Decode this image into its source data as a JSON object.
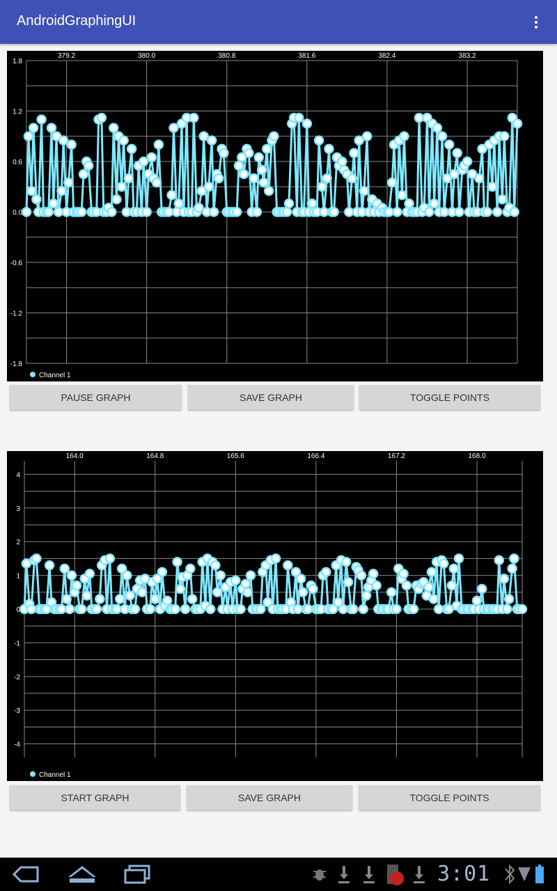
{
  "app": {
    "title": "AndroidGraphingUI",
    "overflow_icon": "more-vert-icon"
  },
  "colors": {
    "appbar": "#3f51b5",
    "series": "#7fe8ff",
    "grid": "#8a8a8a",
    "button": "#d6d6d6"
  },
  "graphs": [
    {
      "buttons": {
        "pause": "PAUSE GRAPH",
        "save": "SAVE GRAPH",
        "toggle": "TOGGLE POINTS"
      },
      "chart_data": {
        "type": "line",
        "x_ticks": [
          "379.2",
          "380.0",
          "380.8",
          "381.6",
          "382.4",
          "383.2"
        ],
        "y_ticks": [
          "1.8",
          "1.2",
          "0.6",
          "0.0",
          "-0.6",
          "-1.2",
          "-1.8"
        ],
        "ylim": [
          -1.8,
          1.8
        ],
        "xlim": [
          378.8,
          383.7
        ],
        "legend": "top-left-below",
        "series": [
          {
            "name": "Channel 1",
            "x": [
              378.8,
              378.82,
              378.85,
              378.87,
              378.9,
              378.92,
              378.95,
              378.97,
              379.0,
              379.02,
              379.05,
              379.07,
              379.1,
              379.12,
              379.15,
              379.17,
              379.2,
              379.22,
              379.25,
              379.27,
              379.3,
              379.32,
              379.35,
              379.37,
              379.4,
              379.42,
              379.45,
              379.47,
              379.5,
              379.52,
              379.55,
              379.57,
              379.6,
              379.62,
              379.65,
              379.67,
              379.7,
              379.72,
              379.75,
              379.77,
              379.8,
              379.82,
              379.85,
              379.87,
              379.9,
              379.92,
              379.95,
              379.97,
              380.0,
              380.02,
              380.05,
              380.07,
              380.1,
              380.12,
              380.15,
              380.17,
              380.2,
              380.22,
              380.25,
              380.27,
              380.3,
              380.32,
              380.35,
              380.37,
              380.4,
              380.42,
              380.45,
              380.47,
              380.5,
              380.52,
              380.55,
              380.57,
              380.6,
              380.62,
              380.65,
              380.67,
              380.7,
              380.72,
              380.75,
              380.77,
              380.8,
              380.82,
              380.85,
              380.87,
              380.9,
              380.92,
              380.95,
              380.97,
              381.0,
              381.02,
              381.05,
              381.07,
              381.1,
              381.12,
              381.15,
              381.17,
              381.2,
              381.22,
              381.25,
              381.27,
              381.3,
              381.32,
              381.35,
              381.37,
              381.4,
              381.42,
              381.45,
              381.47,
              381.5,
              381.52,
              381.55,
              381.57,
              381.6,
              381.62,
              381.65,
              381.67,
              381.7,
              381.72,
              381.75,
              381.77,
              381.8,
              381.82,
              381.85,
              381.87,
              381.9,
              381.92,
              381.95,
              381.97,
              382.0,
              382.02,
              382.05,
              382.07,
              382.1,
              382.12,
              382.15,
              382.17,
              382.2,
              382.22,
              382.25,
              382.27,
              382.3,
              382.32,
              382.35,
              382.37,
              382.4,
              382.42,
              382.45,
              382.47,
              382.5,
              382.52,
              382.55,
              382.57,
              382.6,
              382.62,
              382.65,
              382.67,
              382.7,
              382.72,
              382.75,
              382.77,
              382.8,
              382.82,
              382.85,
              382.87,
              382.9,
              382.92,
              382.95,
              382.97,
              383.0,
              383.02,
              383.05,
              383.07,
              383.1,
              383.12,
              383.15,
              383.17,
              383.2,
              383.22,
              383.25,
              383.27,
              383.3,
              383.32,
              383.35,
              383.37,
              383.4,
              383.42,
              383.45,
              383.47,
              383.5,
              383.52,
              383.55,
              383.57,
              383.6,
              383.62,
              383.65,
              383.67,
              383.7
            ],
            "y": [
              0.0,
              0.9,
              0.25,
              1.0,
              0.15,
              0.0,
              1.1,
              0.0,
              0.0,
              0.0,
              1.0,
              0.1,
              0.9,
              0.0,
              0.25,
              0.85,
              0.0,
              0.35,
              0.8,
              0.0,
              0.0,
              0.0,
              0.0,
              0.45,
              0.6,
              0.55,
              0.0,
              0.0,
              0.0,
              1.1,
              1.12,
              0.0,
              0.0,
              0.05,
              0.0,
              1.0,
              0.15,
              0.9,
              0.3,
              0.85,
              0.0,
              0.4,
              0.75,
              0.0,
              0.0,
              0.55,
              0.0,
              0.6,
              0.0,
              0.45,
              0.65,
              0.4,
              0.35,
              0.8,
              0.0,
              0.0,
              0.0,
              0.0,
              0.2,
              1.0,
              0.0,
              0.1,
              1.05,
              0.0,
              1.12,
              0.0,
              0.0,
              1.12,
              0.0,
              0.05,
              0.25,
              0.9,
              0.0,
              0.3,
              0.85,
              0.0,
              0.45,
              0.4,
              0.75,
              0.7,
              0.0,
              0.0,
              0.0,
              0.0,
              0.0,
              0.55,
              0.65,
              0.45,
              0.75,
              0.7,
              0.0,
              0.4,
              0.0,
              0.65,
              0.5,
              0.35,
              0.75,
              0.25,
              0.85,
              0.9,
              0.0,
              0.0,
              0.0,
              0.0,
              0.0,
              0.1,
              1.05,
              1.12,
              0.0,
              1.12,
              0.0,
              0.0,
              1.05,
              0.0,
              0.1,
              0.0,
              0.0,
              0.85,
              0.3,
              0.0,
              0.4,
              0.75,
              0.0,
              0.0,
              0.65,
              0.55,
              0.6,
              0.5,
              0.45,
              0.0,
              0.4,
              0.7,
              0.0,
              0.85,
              0.0,
              0.25,
              0.9,
              0.0,
              0.15,
              0.0,
              0.1,
              0.0,
              0.05,
              0.0,
              0.0,
              0.0,
              0.35,
              0.8,
              0.0,
              0.85,
              0.2,
              0.9,
              0.0,
              0.1,
              0.0,
              0.0,
              0.0,
              1.12,
              0.0,
              0.05,
              1.12,
              0.0,
              1.05,
              0.1,
              1.0,
              0.0,
              0.9,
              0.0,
              0.4,
              0.8,
              0.0,
              0.45,
              0.7,
              0.0,
              0.5,
              0.55,
              0.6,
              0.0,
              0.45,
              0.0,
              0.0,
              0.4,
              0.75,
              0.0,
              0.0,
              0.8,
              0.3,
              0.85,
              0.0,
              0.9,
              0.15,
              0.9,
              0.0,
              0.05,
              1.12,
              0.0,
              1.05,
              0.1,
              0.0,
              0.0,
              0.05,
              0.25,
              0.9,
              0.8,
              0.05
            ]
          }
        ]
      }
    },
    {
      "buttons": {
        "pause": "START GRAPH",
        "save": "SAVE GRAPH",
        "toggle": "TOGGLE POINTS"
      },
      "chart_data": {
        "type": "line",
        "x_ticks": [
          "164.0",
          "164.8",
          "165.6",
          "166.4",
          "167.2",
          "168.0"
        ],
        "y_ticks": [
          "4",
          "3",
          "2",
          "1",
          "0",
          "-1",
          "-2",
          "-3",
          "-4"
        ],
        "ylim": [
          -4.4,
          4.4
        ],
        "xlim": [
          163.5,
          168.45
        ],
        "legend": "top-left-below",
        "series": [
          {
            "name": "Channel 1",
            "x": [
              163.5,
              163.52,
              163.55,
              163.57,
              163.6,
              163.62,
              163.65,
              163.67,
              163.7,
              163.72,
              163.75,
              163.77,
              163.8,
              163.82,
              163.85,
              163.87,
              163.9,
              163.92,
              163.95,
              163.97,
              164.0,
              164.02,
              164.05,
              164.07,
              164.1,
              164.12,
              164.15,
              164.17,
              164.2,
              164.22,
              164.25,
              164.27,
              164.3,
              164.32,
              164.35,
              164.37,
              164.4,
              164.42,
              164.45,
              164.47,
              164.5,
              164.52,
              164.55,
              164.57,
              164.6,
              164.62,
              164.65,
              164.67,
              164.7,
              164.72,
              164.75,
              164.77,
              164.8,
              164.82,
              164.85,
              164.87,
              164.9,
              164.92,
              164.95,
              164.97,
              165.0,
              165.02,
              165.05,
              165.07,
              165.1,
              165.12,
              165.15,
              165.17,
              165.2,
              165.22,
              165.25,
              165.27,
              165.3,
              165.32,
              165.35,
              165.37,
              165.4,
              165.42,
              165.45,
              165.47,
              165.5,
              165.52,
              165.55,
              165.57,
              165.6,
              165.62,
              165.65,
              165.67,
              165.7,
              165.72,
              165.75,
              165.77,
              165.8,
              165.82,
              165.85,
              165.87,
              165.9,
              165.92,
              165.95,
              165.97,
              166.0,
              166.02,
              166.05,
              166.07,
              166.1,
              166.12,
              166.15,
              166.17,
              166.2,
              166.22,
              166.25,
              166.27,
              166.3,
              166.32,
              166.35,
              166.37,
              166.4,
              166.42,
              166.45,
              166.47,
              166.5,
              166.52,
              166.55,
              166.57,
              166.6,
              166.62,
              166.65,
              166.67,
              166.7,
              166.72,
              166.75,
              166.77,
              166.8,
              166.82,
              166.85,
              166.87,
              166.9,
              166.92,
              166.95,
              166.97,
              167.0,
              167.02,
              167.05,
              167.07,
              167.1,
              167.12,
              167.15,
              167.17,
              167.2,
              167.22,
              167.25,
              167.27,
              167.3,
              167.32,
              167.35,
              167.37,
              167.4,
              167.42,
              167.45,
              167.47,
              167.5,
              167.52,
              167.55,
              167.57,
              167.6,
              167.62,
              167.65,
              167.67,
              167.7,
              167.72,
              167.75,
              167.77,
              167.8,
              167.82,
              167.85,
              167.87,
              167.9,
              167.92,
              167.95,
              167.97,
              168.0,
              168.02,
              168.05,
              168.07,
              168.1,
              168.12,
              168.15,
              168.17,
              168.2,
              168.22,
              168.25,
              168.27,
              168.3,
              168.32,
              168.35,
              168.37,
              168.4,
              168.42,
              168.45
            ],
            "y": [
              0.0,
              1.35,
              0.15,
              0.0,
              1.45,
              1.5,
              0.0,
              0.0,
              0.0,
              0.0,
              1.3,
              0.2,
              0.0,
              0.0,
              0.0,
              0.0,
              1.2,
              0.3,
              0.0,
              1.0,
              0.5,
              0.7,
              0.0,
              0.0,
              0.9,
              0.4,
              1.05,
              0.0,
              0.0,
              0.0,
              0.3,
              1.3,
              1.45,
              0.0,
              1.5,
              0.0,
              0.0,
              0.0,
              0.3,
              1.2,
              0.0,
              1.0,
              0.4,
              0.0,
              0.0,
              0.6,
              0.85,
              0.5,
              0.9,
              0.0,
              0.0,
              0.8,
              0.3,
              0.9,
              0.0,
              1.1,
              0.1,
              0.25,
              0.0,
              0.0,
              0.0,
              1.4,
              0.6,
              0.95,
              0.0,
              1.0,
              1.2,
              0.3,
              0.0,
              0.0,
              0.0,
              1.4,
              0.1,
              1.5,
              0.0,
              1.4,
              1.3,
              0.5,
              1.0,
              0.0,
              0.65,
              0.0,
              0.8,
              0.0,
              0.85,
              0.0,
              0.0,
              0.6,
              0.75,
              0.5,
              1.0,
              0.0,
              0.0,
              0.0,
              0.0,
              1.1,
              1.3,
              0.2,
              1.45,
              0.0,
              1.5,
              0.0,
              0.0,
              0.0,
              0.0,
              1.3,
              0.2,
              0.0,
              1.1,
              0.0,
              0.9,
              0.5,
              0.0,
              0.0,
              0.7,
              0.6,
              0.0,
              0.0,
              0.0,
              1.0,
              1.1,
              0.0,
              0.0,
              0.0,
              1.3,
              0.2,
              1.45,
              0.0,
              1.4,
              0.8,
              0.0,
              0.0,
              1.25,
              1.15,
              1.0,
              0.0,
              0.4,
              0.65,
              0.85,
              1.05,
              0.7,
              0.0,
              0.0,
              0.0,
              0.0,
              0.0,
              0.5,
              0.0,
              0.0,
              1.2,
              0.9,
              1.05,
              0.7,
              0.0,
              0.0,
              0.0,
              0.7,
              0.6,
              0.75,
              0.8,
              0.4,
              0.65,
              1.1,
              0.3,
              1.4,
              0.0,
              1.45,
              1.35,
              0.0,
              0.0,
              0.7,
              1.2,
              0.1,
              1.5,
              0.0,
              0.0,
              0.0,
              0.0,
              0.0,
              0.0,
              0.25,
              0.0,
              0.6,
              0.0,
              0.0,
              0.0,
              0.0,
              0.0,
              0.0,
              1.45,
              0.0,
              0.9,
              0.0,
              0.3,
              1.2,
              1.5,
              0.0,
              0.0,
              0.0
            ]
          }
        ]
      }
    }
  ],
  "navbar": {
    "back_icon": "back-icon",
    "home_icon": "home-icon",
    "recents_icon": "recent-apps-icon",
    "clock": "3:01",
    "status_icons": [
      "debug-bug-icon",
      "download-icon",
      "download-icon",
      "sd-card-icon",
      "download-icon",
      "bluetooth-icon",
      "signal-icon",
      "battery-icon"
    ]
  }
}
